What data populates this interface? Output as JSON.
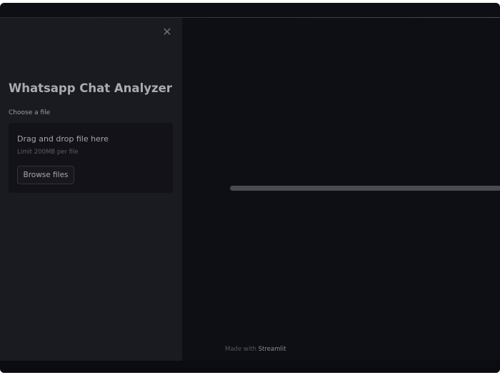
{
  "sidebar": {
    "close_icon": "close-icon",
    "close_glyph": "✕",
    "title": "Whatsapp Chat Analyzer",
    "uploader": {
      "label": "Choose a file",
      "drop_text": "Drag and drop file here",
      "limit_text": "Limit 200MB per file",
      "browse_label": "Browse files"
    }
  },
  "main": {
    "progress": {
      "fraction": 1.0
    }
  },
  "footer": {
    "prefix": "Made with",
    "brand": "Streamlit"
  },
  "colors": {
    "background": "#0e0f14",
    "sidebar": "#1a1a21",
    "dropzone": "#121218",
    "accent_line": "#8a4a3a"
  }
}
